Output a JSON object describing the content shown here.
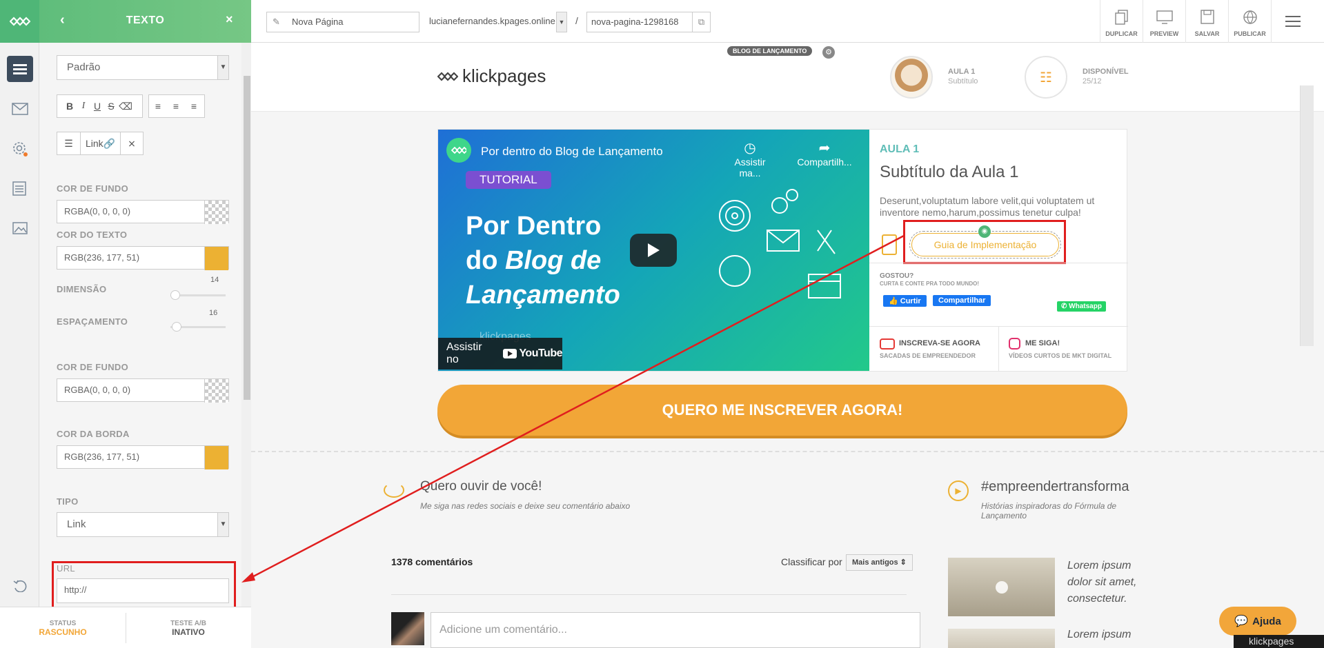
{
  "panel": {
    "title": "TEXTO",
    "font_select": "Padrão",
    "link_label": "Link",
    "bg_color_label": "COR DE FUNDO",
    "bg_color_value": "RGBA(0, 0, 0, 0)",
    "text_color_label": "COR DO TEXTO",
    "text_color_value": "RGB(236, 177, 51)",
    "size_label": "DIMENSÃO",
    "size_value": "14",
    "spacing_label": "ESPAÇAMENTO",
    "spacing_value": "16",
    "bg_color2_label": "COR DE FUNDO",
    "bg_color2_value": "RGBA(0, 0, 0, 0)",
    "border_color_label": "COR DA BORDA",
    "border_color_value": "RGB(236, 177, 51)",
    "type_label": "TIPO",
    "type_value": "Link",
    "url_label": "URL",
    "url_placeholder": "http://"
  },
  "status": {
    "status_label": "STATUS",
    "status_value": "RASCUNHO",
    "ab_label": "TESTE A/B",
    "ab_value": "INATIVO"
  },
  "topbar": {
    "page_name": "Nova Página",
    "domain": "lucianefernandes.kpages.online",
    "separator": "/",
    "slug": "nova-pagina-1298168",
    "duplicate": "DUPLICAR",
    "preview": "PREVIEW",
    "save": "SALVAR",
    "publish": "PUBLICAR"
  },
  "page": {
    "section_badge": "BLOG DE LANÇAMENTO",
    "brand": "klickpages",
    "lesson_label": "AULA 1",
    "lesson_sub": "Subtítulo",
    "available_label": "DISPONÍVEL",
    "available_date": "25/12",
    "video_title": "Por dentro do Blog de Lançamento",
    "video_tag": "TUTORIAL",
    "video_line1": "Por Dentro",
    "video_line2a": "do ",
    "video_line2b": "Blog de",
    "video_line3": "Lançamento",
    "watch_later": "Assistir ma...",
    "share": "Compartilh...",
    "watch_on": "Assistir no",
    "youtube": "YouTube",
    "video_watermark": "klickpages",
    "aula_tag": "AULA 1",
    "aula_title": "Subtítulo da Aula 1",
    "aula_desc": "Deserunt,voluptatum labore velit,qui voluptatem ut inventore nemo,harum,possimus tenetur culpa!",
    "guide_button": "Guia de Implementação",
    "gostou": "GOSTOU?",
    "gostou_sub": "CURTA E CONTE PRA TODO MUNDO!",
    "like": "Curtir",
    "share_fb": "Compartilhar",
    "whatsapp": "Whatsapp",
    "subscribe_title": "INSCREVA-SE AGORA",
    "subscribe_sub": "SACADAS DE EMPREENDEDOR",
    "follow_title": "ME SIGA!",
    "follow_sub": "VÍDEOS CURTOS DE MKT DIGITAL",
    "cta": "QUERO ME INSCREVER AGORA!",
    "comments_heading": "Quero ouvir de você!",
    "comments_sub": "Me siga nas redes sociais e deixe seu comentário abaixo",
    "hashtag_heading": "#empreendertransforma",
    "hashtag_sub": "Histórias inspiradoras do Fórmula de Lançamento",
    "comment_count": "1378 comentários",
    "sort_label": "Classificar por",
    "sort_value": "Mais antigos",
    "comment_placeholder": "Adicione um comentário...",
    "lorem1": "Lorem ipsum dolor sit amet, consectetur.",
    "lorem2": "Lorem ipsum",
    "help": "Ajuda",
    "footer_brand": "klickpages"
  },
  "colors": {
    "green": "#5fbd7b",
    "orange": "#f2a637",
    "text_color": "#ecb133",
    "annotation": "#e01e1e"
  }
}
